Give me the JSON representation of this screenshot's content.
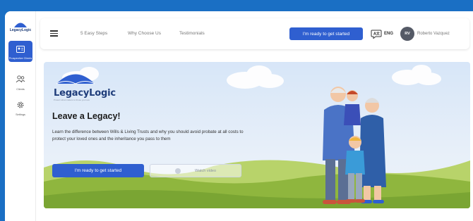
{
  "sidebar": {
    "logo_text": "LegacyLogic",
    "items": [
      {
        "label": "Prospective Clients",
        "icon": "address-card-icon",
        "active": true
      },
      {
        "label": "Clients",
        "icon": "users-icon",
        "active": false
      },
      {
        "label": "Settings",
        "icon": "gear-icon",
        "active": false
      }
    ]
  },
  "topbar": {
    "nav": [
      "5 Easy Steps",
      "Why Choose Us",
      "Testimonials"
    ],
    "cta": "I'm ready to get started",
    "language": "ENG",
    "avatar_initials": "RV",
    "user_name": "Roberto Vazquez"
  },
  "hero": {
    "brand": "LegacyLogic",
    "brand_tagline": "Protect what matters to those you love",
    "headline": "Leave a Legacy!",
    "description": "Learn the difference between Wills & Living Trusts and why you should avoid probate at all costs to protect your loved ones and the inheritance you pass to them",
    "cta": "I'm ready to get started",
    "secondary": "Watch video"
  },
  "colors": {
    "accent": "#2f5fd0",
    "background": "#1a6fc4",
    "brand": "#1f3d7a"
  }
}
